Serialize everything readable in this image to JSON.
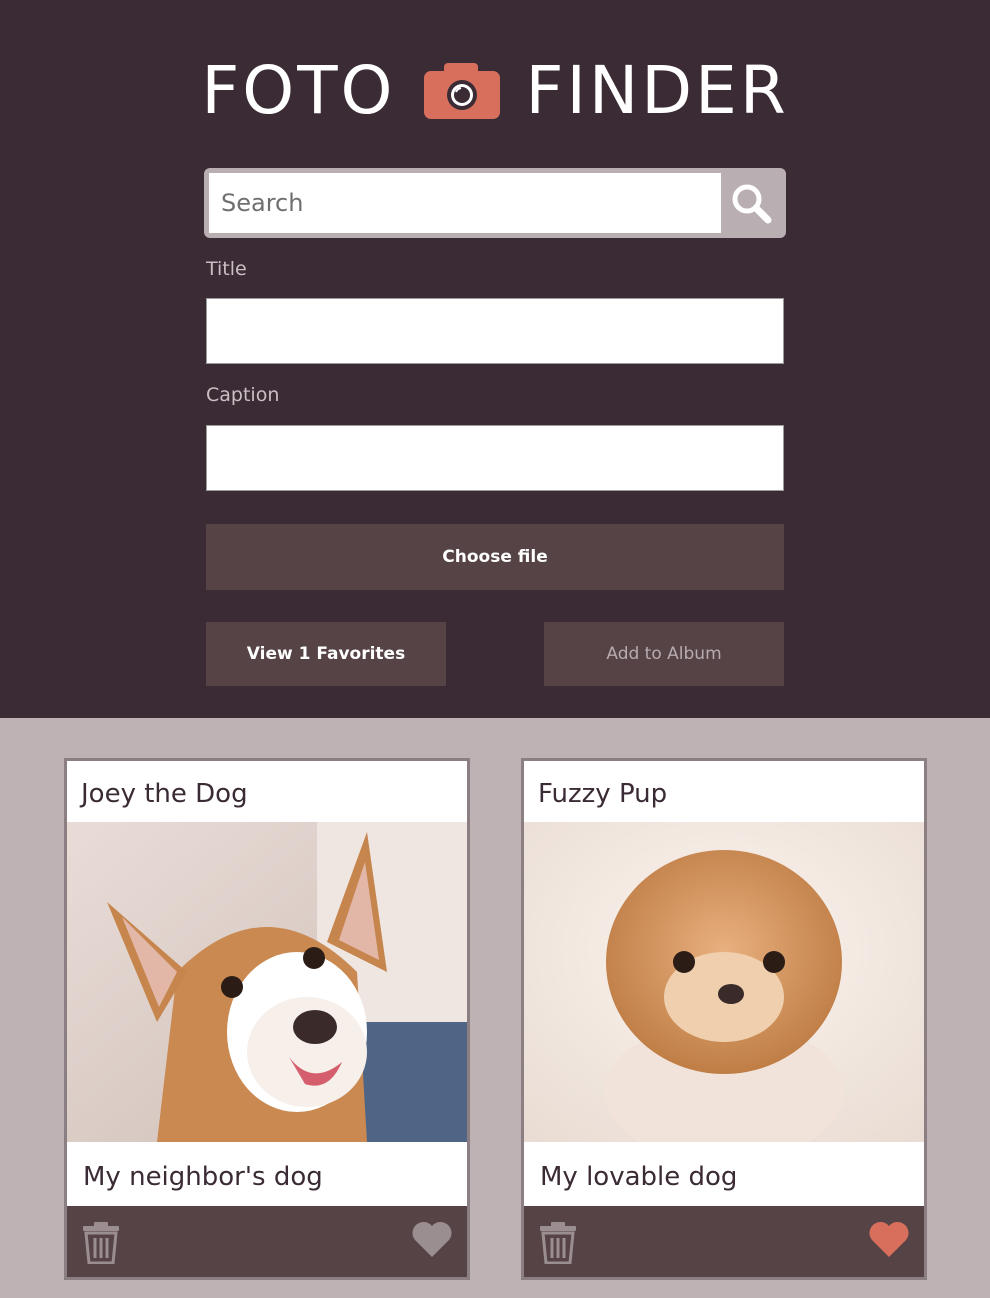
{
  "app": {
    "logo_left": "FOTO",
    "logo_right": "FINDER",
    "accent_color": "#d86f5d"
  },
  "search": {
    "placeholder": "Search",
    "value": "",
    "icon": "search-icon"
  },
  "form": {
    "title_label": "Title",
    "title_value": "",
    "caption_label": "Caption",
    "caption_value": "",
    "choose_file_label": "Choose file",
    "view_favorites_label": "View 1 Favorites",
    "add_album_label": "Add to Album"
  },
  "cards": [
    {
      "title": "Joey the Dog",
      "caption": "My neighbor's dog",
      "favorited": false,
      "image": "corgi puppy photo"
    },
    {
      "title": "Fuzzy Pup",
      "caption": "My lovable dog",
      "favorited": true,
      "image": "pomeranian photo"
    }
  ],
  "colors": {
    "header_bg": "#3a2b35",
    "body_bg": "#beb2b4",
    "button_bg": "#554346",
    "heart_active": "#d86f5d",
    "heart_inactive": "#9b8e91"
  }
}
